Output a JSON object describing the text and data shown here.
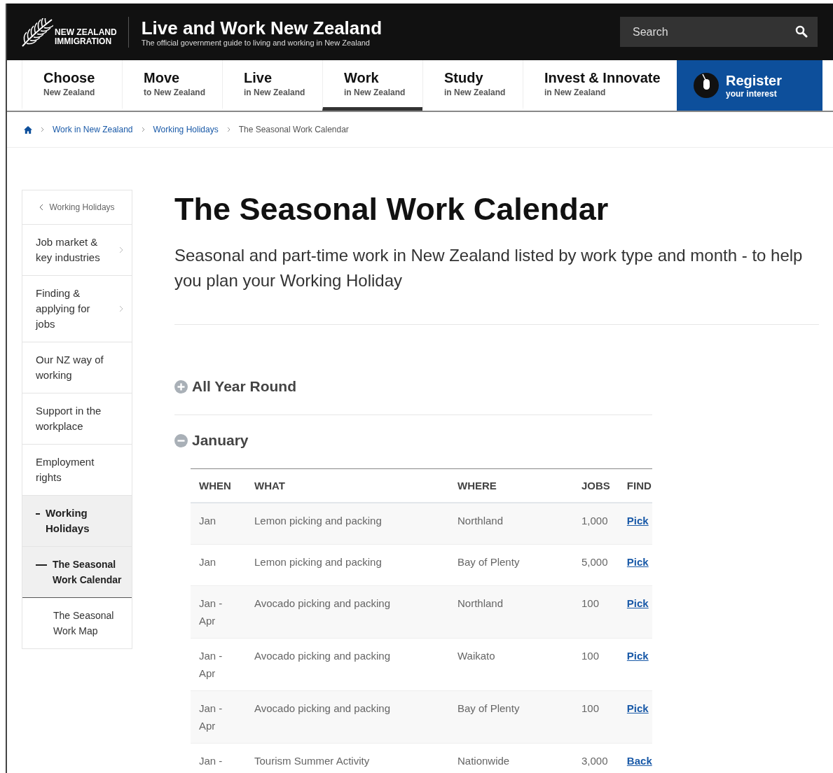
{
  "header": {
    "logo_lines": [
      "NEW ZEALAND",
      "IMMIGRATION"
    ],
    "title": "Live and Work New Zealand",
    "subtitle": "The official government guide to living and working in New Zealand",
    "search": {
      "placeholder": "Search"
    }
  },
  "nav": [
    {
      "label": "Choose",
      "sub": "New Zealand",
      "selected": false
    },
    {
      "label": "Move",
      "sub": "to New Zealand",
      "selected": false
    },
    {
      "label": "Live",
      "sub": "in New Zealand",
      "selected": false
    },
    {
      "label": "Work",
      "sub": "in New Zealand",
      "selected": true
    },
    {
      "label": "Study",
      "sub": "in New Zealand",
      "selected": false
    },
    {
      "label": "Invest & Innovate",
      "sub": "in New Zealand",
      "selected": false
    }
  ],
  "register": {
    "label": "Register",
    "sub": "your interest"
  },
  "breadcrumb": [
    "Work in New Zealand",
    "Working Holidays",
    "The Seasonal Work Calendar"
  ],
  "sidebar": {
    "back": "Working Holidays",
    "items": [
      {
        "label": "Job market & key industries",
        "has_submenu": true,
        "selected": false
      },
      {
        "label": "Finding & applying for jobs",
        "has_submenu": true,
        "selected": false
      },
      {
        "label": "Our NZ way of working",
        "has_submenu": false,
        "selected": false
      },
      {
        "label": "Support in the workplace",
        "has_submenu": false,
        "selected": false
      },
      {
        "label": "Employment rights",
        "has_submenu": false,
        "selected": false
      },
      {
        "label": "Working Holidays",
        "has_submenu": false,
        "selected": true,
        "children": [
          {
            "label": "The Seasonal Work Calendar",
            "has_submenu": false,
            "selected": true
          },
          {
            "label": "The Seasonal Work Map",
            "has_submenu": false,
            "selected": false
          }
        ]
      }
    ]
  },
  "page": {
    "title": "The Seasonal Work Calendar",
    "intro": "Seasonal and part-time work in New Zealand listed by work type and month - to help you plan your Working Holiday"
  },
  "sections": [
    {
      "title": "All Year Round",
      "expanded": false
    },
    {
      "title": "January",
      "expanded": true,
      "table": {
        "columns": [
          "WHEN",
          "WHAT",
          "WHERE",
          "JOBS",
          "FIND"
        ],
        "rows": [
          {
            "when": "Jan",
            "what": "Lemon picking and packing",
            "where": "Northland",
            "jobs": "1,000",
            "link": "Pick"
          },
          {
            "when": "Jan",
            "what": "Lemon picking and packing",
            "where": "Bay of Plenty",
            "jobs": "5,000",
            "link": "Pick"
          },
          {
            "when": "Jan - Apr",
            "what": "Avocado picking and packing",
            "where": "Northland",
            "jobs": "100",
            "link": "Pick"
          },
          {
            "when": "Jan - Apr",
            "what": "Avocado picking and packing",
            "where": "Waikato",
            "jobs": "100",
            "link": "Pick"
          },
          {
            "when": "Jan - Apr",
            "what": "Avocado picking and packing",
            "where": "Bay of Plenty",
            "jobs": "100",
            "link": "Pick"
          },
          {
            "when": "Jan -",
            "what": "Tourism Summer Activity",
            "where": "Nationwide",
            "jobs": "3,000",
            "link": "Back"
          }
        ]
      }
    }
  ]
}
